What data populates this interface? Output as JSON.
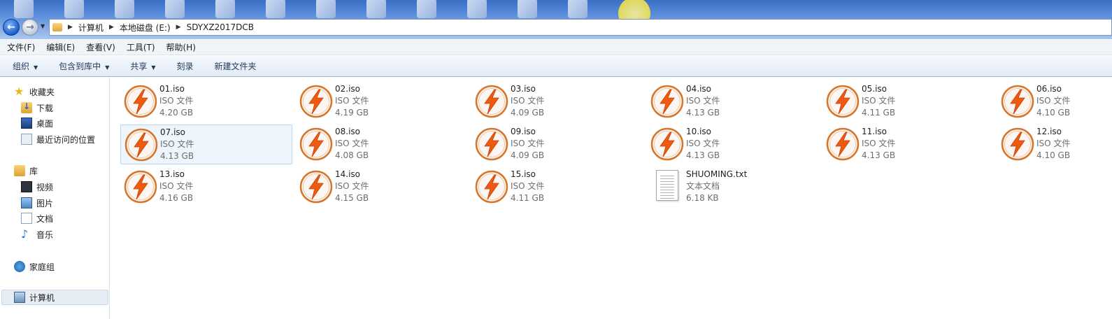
{
  "address": {
    "crumbs": [
      "计算机",
      "本地磁盘 (E:)",
      "SDYXZ2017DCB"
    ]
  },
  "menu": [
    "文件(F)",
    "编辑(E)",
    "查看(V)",
    "工具(T)",
    "帮助(H)"
  ],
  "toolbar": {
    "organize": "组织",
    "include_library": "包含到库中",
    "share": "共享",
    "burn": "刻录",
    "new_folder": "新建文件夹"
  },
  "sidebar": {
    "favorites": "收藏夹",
    "downloads": "下载",
    "desktop": "桌面",
    "recent": "最近访问的位置",
    "libraries": "库",
    "videos": "视频",
    "pictures": "图片",
    "documents": "文档",
    "music": "音乐",
    "homegroup": "家庭组",
    "computer": "计算机"
  },
  "files": [
    {
      "name": "01.iso",
      "type": "ISO 文件",
      "size": "4.20 GB"
    },
    {
      "name": "02.iso",
      "type": "ISO 文件",
      "size": "4.19 GB"
    },
    {
      "name": "03.iso",
      "type": "ISO 文件",
      "size": "4.09 GB"
    },
    {
      "name": "04.iso",
      "type": "ISO 文件",
      "size": "4.13 GB"
    },
    {
      "name": "05.iso",
      "type": "ISO 文件",
      "size": "4.11 GB"
    },
    {
      "name": "06.iso",
      "type": "ISO 文件",
      "size": "4.10 GB"
    },
    {
      "name": "07.iso",
      "type": "ISO 文件",
      "size": "4.13 GB"
    },
    {
      "name": "08.iso",
      "type": "ISO 文件",
      "size": "4.08 GB"
    },
    {
      "name": "09.iso",
      "type": "ISO 文件",
      "size": "4.09 GB"
    },
    {
      "name": "10.iso",
      "type": "ISO 文件",
      "size": "4.13 GB"
    },
    {
      "name": "11.iso",
      "type": "ISO 文件",
      "size": "4.13 GB"
    },
    {
      "name": "12.iso",
      "type": "ISO 文件",
      "size": "4.10 GB"
    },
    {
      "name": "13.iso",
      "type": "ISO 文件",
      "size": "4.16 GB"
    },
    {
      "name": "14.iso",
      "type": "ISO 文件",
      "size": "4.15 GB"
    },
    {
      "name": "15.iso",
      "type": "ISO 文件",
      "size": "4.11 GB"
    },
    {
      "name": "SHUOMING.txt",
      "type": "文本文档",
      "size": "6.18 KB"
    }
  ]
}
